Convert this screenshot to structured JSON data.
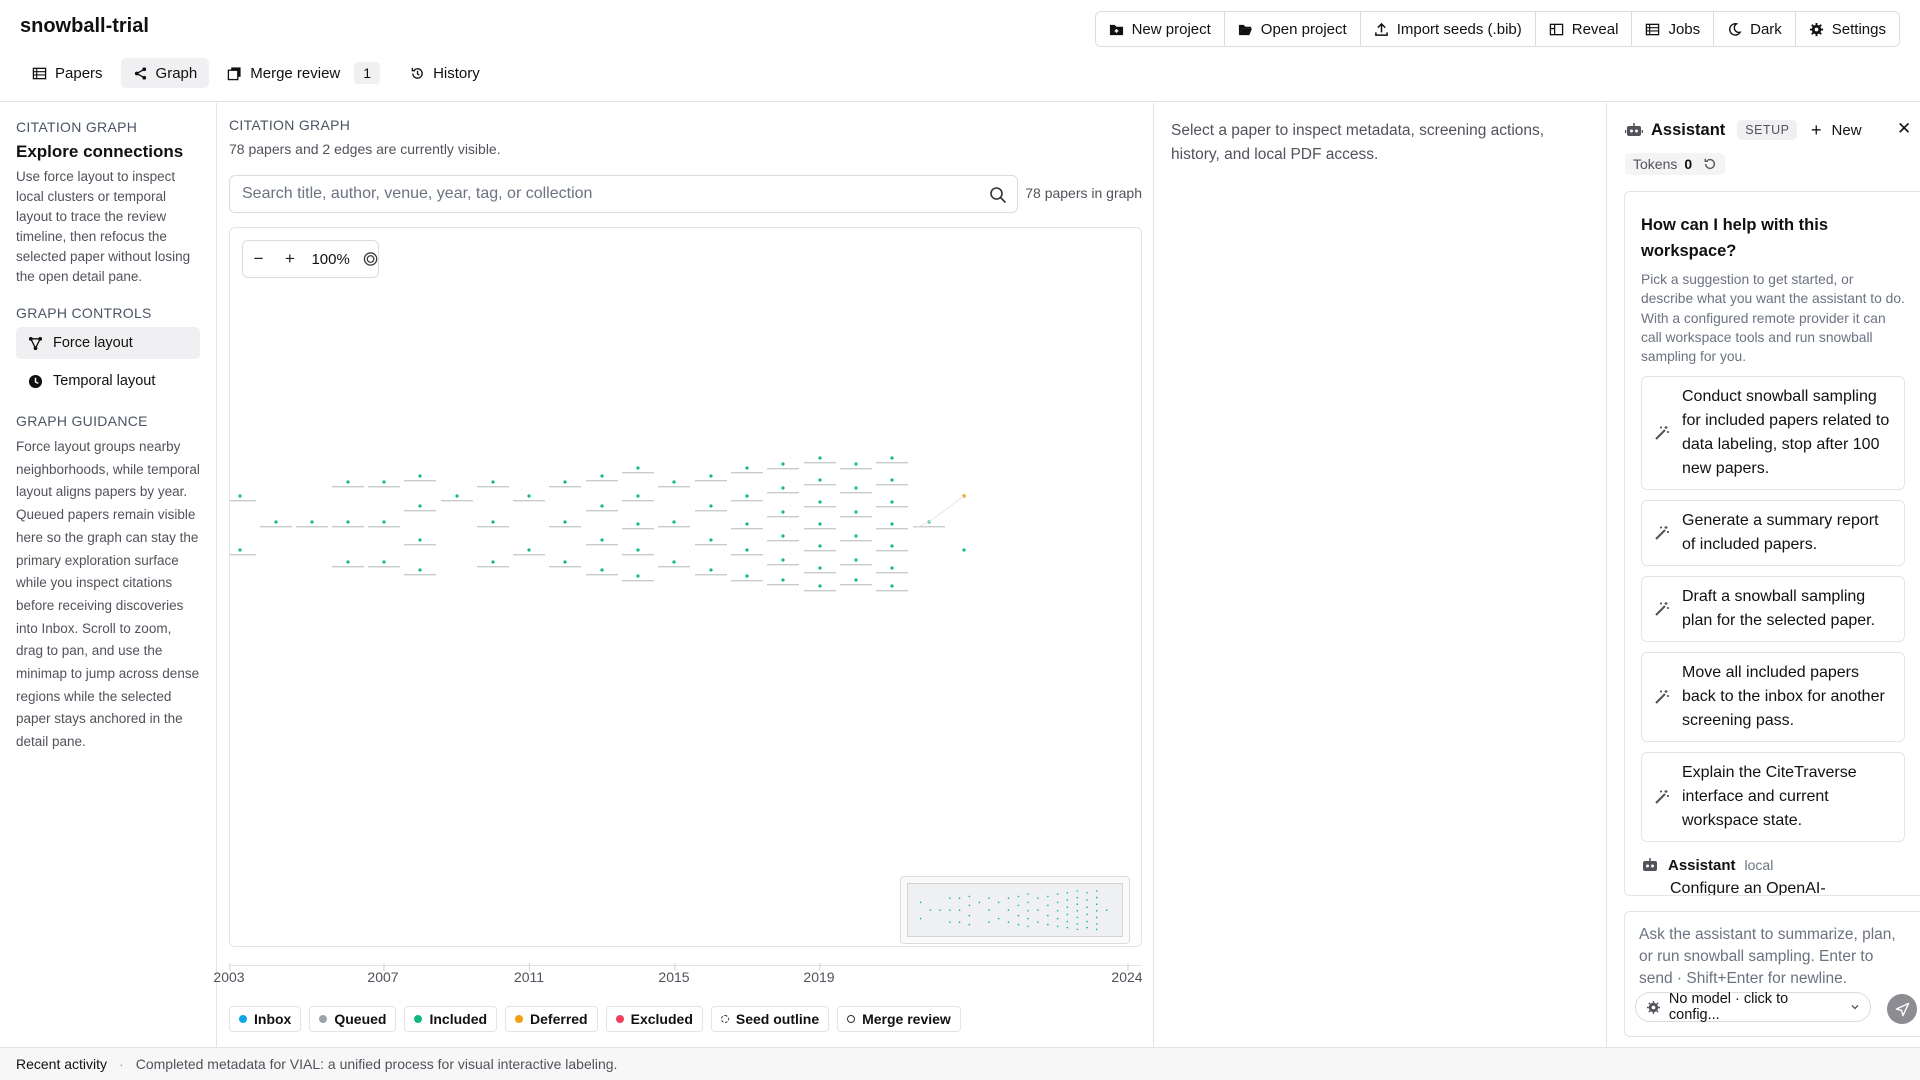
{
  "app": {
    "title": "snowball-trial"
  },
  "toolbar": {
    "new_project": "New project",
    "open_project": "Open project",
    "import_seeds": "Import seeds (.bib)",
    "reveal": "Reveal",
    "jobs": "Jobs",
    "dark": "Dark",
    "settings": "Settings"
  },
  "tabs": [
    {
      "label": "Papers",
      "icon": "table-icon"
    },
    {
      "label": "Graph",
      "icon": "share-icon",
      "active": true
    },
    {
      "label": "Merge review",
      "icon": "copy-icon",
      "badge": "1"
    },
    {
      "label": "History",
      "icon": "history-icon"
    }
  ],
  "sidebar": {
    "section_label": "CITATION GRAPH",
    "title": "Explore connections",
    "description": "Use force layout to inspect local clusters or temporal layout to trace the review timeline, then refocus the selected paper without losing the open detail pane.",
    "controls_label": "GRAPH CONTROLS",
    "force_layout": "Force layout",
    "temporal_layout": "Temporal layout",
    "guidance_label": "GRAPH GUIDANCE",
    "guidance_text": "Force layout groups nearby neighborhoods, while temporal layout aligns papers by year. Queued papers remain visible here so the graph can stay the primary exploration surface while you inspect citations before receiving discoveries into Inbox. Scroll to zoom, drag to pan, and use the minimap to jump across dense regions while the selected paper stays anchored in the detail pane."
  },
  "graph": {
    "label": "CITATION GRAPH",
    "status": "78 papers and 2 edges are currently visible.",
    "search_placeholder": "Search title, author, venue, year, tag, or collection",
    "papers_count": "78 papers in graph",
    "zoom": "100%",
    "timeline_ticks": [
      "2003",
      "2007",
      "2011",
      "2015",
      "2019",
      "2024"
    ],
    "legend": [
      {
        "label": "Inbox",
        "color": "#0ea5e9"
      },
      {
        "label": "Queued",
        "color": "#9ca3af"
      },
      {
        "label": "Included",
        "color": "#10b981"
      },
      {
        "label": "Deferred",
        "color": "#f59e0b"
      },
      {
        "label": "Excluded",
        "color": "#f43f5e"
      },
      {
        "label": "Seed outline",
        "color": "dashed"
      },
      {
        "label": "Merge review",
        "color": "outline"
      }
    ],
    "node_color": "#10b981",
    "deferred_color": "#f59e0b"
  },
  "detail": {
    "placeholder": "Select a paper to inspect metadata, screening actions, history, and local PDF access."
  },
  "assistant": {
    "title": "Assistant",
    "setup_badge": "SETUP",
    "new_label": "New",
    "tokens_label": "Tokens",
    "tokens_value": "0",
    "help_title": "How can I help with this workspace?",
    "help_desc": "Pick a suggestion to get started, or describe what you want the assistant to do. With a configured remote provider it can call workspace tools and run snowball sampling for you.",
    "suggestions": [
      "Conduct snowball sampling for included papers related to data labeling, stop after 100 new papers.",
      "Generate a summary report of included papers.",
      "Draft a snowball sampling plan for the selected paper.",
      "Move all included papers back to the inbox for another screening pass.",
      "Explain the CiteTraverse interface and current workspace state."
    ],
    "message_author": "Assistant",
    "message_meta": "local",
    "message_text": "Configure an OpenAI-",
    "composer_placeholder": "Ask the assistant to summarize, plan, or run snowball sampling. Enter to send · Shift+Enter for newline.",
    "model_label": "No model · click to config..."
  },
  "footer": {
    "label": "Recent activity",
    "activity": "Completed metadata for VIAL: a unified process for visual interactive labeling."
  }
}
